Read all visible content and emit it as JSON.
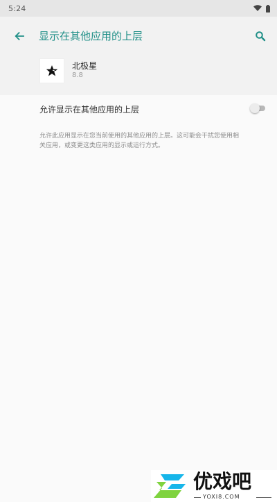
{
  "status_bar": {
    "time": "5:24",
    "icons": [
      "wifi-icon",
      "battery-icon"
    ]
  },
  "toolbar": {
    "title": "显示在其他应用的上层",
    "back_icon": "back-arrow-icon",
    "search_icon": "search-icon"
  },
  "app": {
    "name": "北极星",
    "version": "8.8",
    "icon": "star-app-icon"
  },
  "permission": {
    "label": "允许显示在其他应用的上层",
    "enabled": false,
    "description": "允许此应用显示在您当前使用的其他应用的上层。这可能会干扰您使用相\n关应用，或变更这类应用的显示或运行方式。"
  },
  "colors": {
    "accent": "#1f8f87",
    "background": "#fafafa",
    "header_background": "#f2f2f2",
    "statusbar_background": "#e6e6e6"
  },
  "watermark": {
    "text": "优戏吧",
    "domain": "YOXI8.COM",
    "logo_colors": [
      "#17b6ea",
      "#7fd33f"
    ]
  }
}
